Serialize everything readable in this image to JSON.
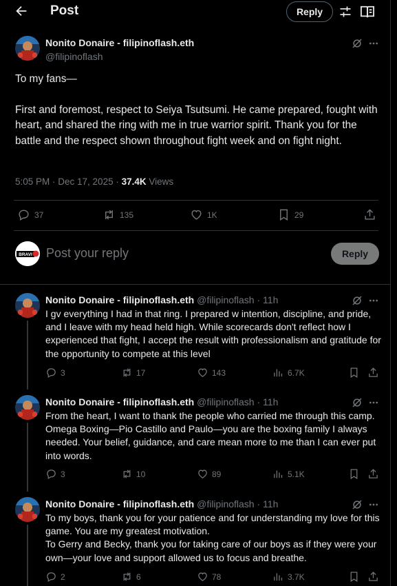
{
  "header": {
    "title": "Post",
    "reply_button": "Reply",
    "back_icon": "arrow-left-icon",
    "filter_icon": "filter-icon",
    "reader_icon": "reader-icon"
  },
  "main_post": {
    "author_name": "Nonito Donaire - filipinoflash.eth",
    "handle": "@filipinoflash",
    "paragraphs": [
      "To my fans—",
      "First and foremost, respect to Seiya Tsutsumi. He came prepared, fought with heart, and shared the ring with me in true warrior spirit. Thank you for the battle and the respect shown throughout fight week and on fight night."
    ],
    "timestamp": "5:05 PM · Dec 17, 2025 · ",
    "views_count": "37.4K",
    "views_label": " Views",
    "stats": {
      "replies": "37",
      "reposts": "135",
      "likes": "1K",
      "bookmarks": "29"
    }
  },
  "composer": {
    "placeholder": "Post your reply",
    "button": "Reply",
    "avatar_text": "BRAVI"
  },
  "replies": [
    {
      "name": "Nonito Donaire - filipinoflash.eth",
      "handle": "@filipinoflash",
      "time": "· 11h",
      "text": "I gv everything I had in that ring. I prepared w intention, discipline, and pride, and I leave with my head held high. While  scorecards don't reflect how I experienced that fight, I accept the result with professionalism and gratitude for the opportunity to compete at this level",
      "replies": "3",
      "reposts": "17",
      "likes": "143",
      "views": "6.7K"
    },
    {
      "name": "Nonito Donaire - filipinoflash.eth",
      "handle": "@filipinoflash",
      "time": "· 11h",
      "text": "From the heart, I want to thank the people who carried me through this camp. Omega Boxing—Pio Castillo and Paulo—you are the boxing family I always needed. Your belief, guidance, and care mean more to me than I can ever put into words.",
      "replies": "3",
      "reposts": "10",
      "likes": "89",
      "views": "5.1K"
    },
    {
      "name": "Nonito Donaire - filipinoflash.eth",
      "handle": "@filipinoflash",
      "time": "· 11h",
      "text": "To my boys, thank you for your patience and for understanding my love for this game. You are my greatest motivation.\nTo Gerry and Becky, thank you for taking care of our boys as if they were your own—your love and support allowed us to focus and breathe.",
      "replies": "2",
      "reposts": "6",
      "likes": "78",
      "views": "3.7K"
    }
  ],
  "colors": {
    "background": "#000000",
    "text": "#e7e9ea",
    "muted": "#71767b",
    "border": "#2f3336",
    "reply_button_disabled": "#787a7a"
  }
}
